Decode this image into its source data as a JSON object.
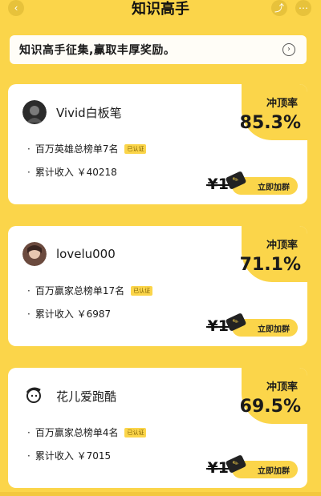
{
  "header": {
    "title": "知识高手"
  },
  "notice": {
    "text": "知识高手征集,赢取丰厚奖励。"
  },
  "rate_label": "冲顶率",
  "tag_text": "已认证",
  "cards": [
    {
      "name": "Vivid白板笔",
      "rank": "百万英雄总榜单7名",
      "income": "累计收入 ￥40218",
      "rate": "85.3%",
      "price": "¥1",
      "join": "立即加群"
    },
    {
      "name": "lovelu000",
      "rank": "百万赢家总榜单17名",
      "income": "累计收入 ￥6987",
      "rate": "71.1%",
      "price": "¥1",
      "join": "立即加群"
    },
    {
      "name": "花儿爱跑酷",
      "rank": "百万赢家总榜单4名",
      "income": "累计收入 ￥7015",
      "rate": "69.5%",
      "price": "¥1",
      "join": "立即加群"
    }
  ],
  "icons": {
    "back": "back-icon",
    "share": "share-icon",
    "more": "more-icon",
    "arrow": "chevron-right-icon",
    "ticket": "ticket-icon"
  },
  "colors": {
    "accent": "#fbd54a",
    "card": "#ffffff"
  }
}
